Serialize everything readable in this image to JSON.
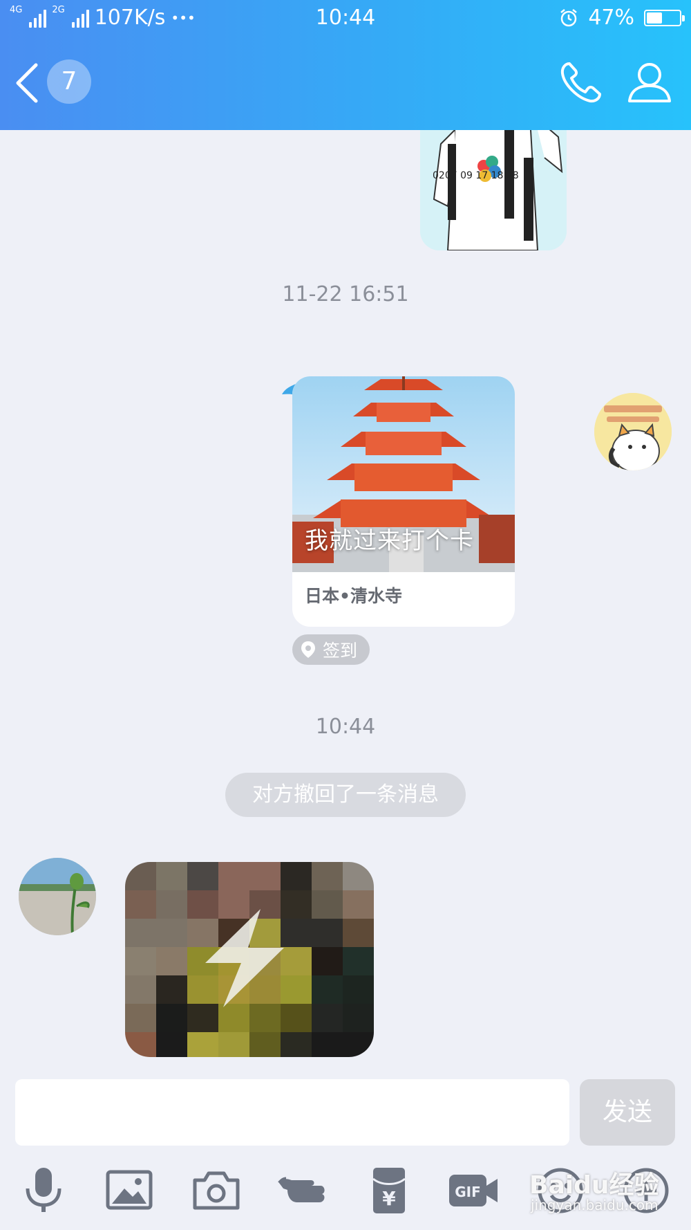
{
  "status_bar": {
    "network_1": "4G",
    "network_2": "4G",
    "network_3": "2G",
    "speed": "107K/s",
    "more": "•••",
    "time": "10:44",
    "battery_text": "47%",
    "battery_level": 0.47
  },
  "nav": {
    "unread_count": "7"
  },
  "chat": {
    "timestamp_1": "11-22 16:51",
    "checkin_card": {
      "overlay_text": "我就过来打个卡",
      "location": "日本•清水寺"
    },
    "checkin_tag": "签到",
    "timestamp_2": "10:44",
    "recall_notice": "对方撤回了一条消息"
  },
  "input": {
    "send_label": "发送"
  },
  "toolbar": {
    "icons": [
      "microphone-icon",
      "image-icon",
      "camera-icon",
      "poke-icon",
      "red-packet-icon",
      "gif-icon",
      "emoji-icon",
      "plus-icon"
    ]
  },
  "watermark": {
    "brand": "Baidu经验",
    "url": "jingyan.baidu.com"
  },
  "colors": {
    "header_start": "#4a8ef2",
    "header_end": "#27c2fb",
    "background": "#eef0f7",
    "icon_gray": "#6d7482"
  }
}
